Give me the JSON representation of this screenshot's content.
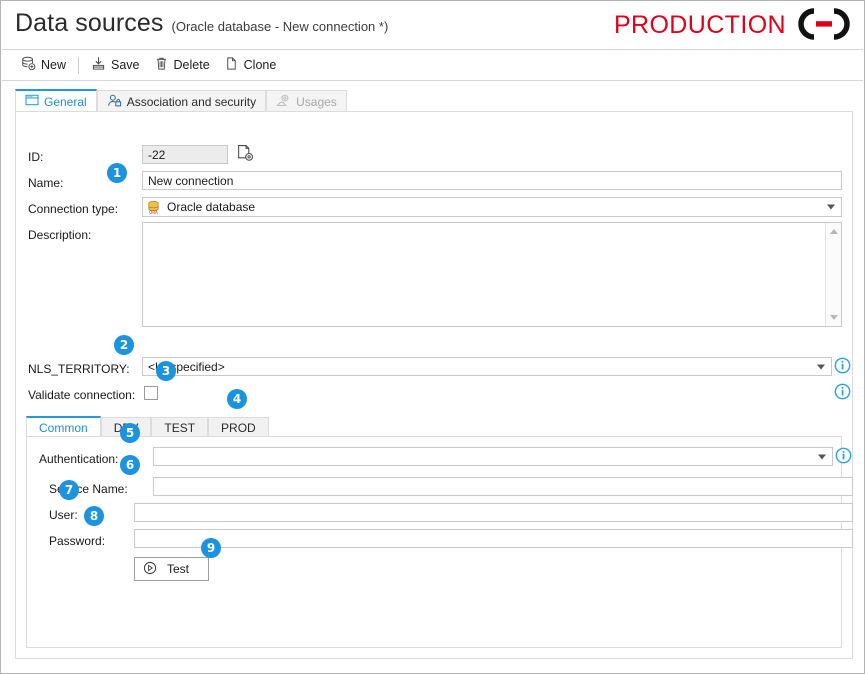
{
  "header": {
    "title": "Data sources",
    "subtitle": "(Oracle database - New connection *)",
    "brand": "PRODUCTION",
    "brand_color": "#e2001a",
    "brand_mark": "chain-link-icon"
  },
  "toolbar": {
    "items": [
      {
        "label": "New",
        "icon": "new-datasource-icon"
      },
      {
        "label": "Save",
        "icon": "save-icon"
      },
      {
        "label": "Delete",
        "icon": "trash-icon"
      },
      {
        "label": "Clone",
        "icon": "clone-icon"
      }
    ]
  },
  "tabs": [
    {
      "label": "General",
      "icon": "form-window-icon",
      "active": true,
      "disabled": false
    },
    {
      "label": "Association and security",
      "icon": "user-lock-icon",
      "active": false,
      "disabled": false
    },
    {
      "label": "Usages",
      "icon": "usages-icon",
      "active": false,
      "disabled": true
    }
  ],
  "form": {
    "id": {
      "label": "ID:",
      "value": "-22",
      "action_icon": "page-gear-icon"
    },
    "name": {
      "label": "Name:",
      "value": "New connection",
      "placeholder": ""
    },
    "connection_type": {
      "label": "Connection type:",
      "value": "Oracle database",
      "icon": "oracle-database-icon"
    },
    "description": {
      "label": "Description:",
      "value": "",
      "placeholder": ""
    },
    "nls_territory": {
      "label": "NLS_TERRITORY:",
      "value": "<Unspecified>"
    },
    "validate_connection": {
      "label": "Validate connection:",
      "checked": false
    }
  },
  "env_tabs": [
    {
      "label": "Common",
      "active": true
    },
    {
      "label": "DEV",
      "active": false
    },
    {
      "label": "TEST",
      "active": false
    },
    {
      "label": "PROD",
      "active": false
    }
  ],
  "connection_fields": {
    "authentication": {
      "label": "Authentication:",
      "value": ""
    },
    "service_name": {
      "label": "Service Name:",
      "value": ""
    },
    "user": {
      "label": "User:",
      "value": ""
    },
    "password": {
      "label": "Password:",
      "value": ""
    },
    "test_button": {
      "label": "Test",
      "icon": "play-circle-icon"
    }
  },
  "callouts": [
    {
      "n": "1",
      "target": "connection-type-row"
    },
    {
      "n": "2",
      "target": "nls-territory-row"
    },
    {
      "n": "3",
      "target": "validate-connection-checkbox"
    },
    {
      "n": "4",
      "target": "env-tabstrip"
    },
    {
      "n": "5",
      "target": "authentication-row"
    },
    {
      "n": "6",
      "target": "service-name-row"
    },
    {
      "n": "7",
      "target": "user-row"
    },
    {
      "n": "8",
      "target": "password-row"
    },
    {
      "n": "9",
      "target": "test-button"
    }
  ],
  "colors": {
    "accent": "#1b93e0",
    "brand": "#e2001a",
    "tab_active_text": "#1f8ed6"
  }
}
